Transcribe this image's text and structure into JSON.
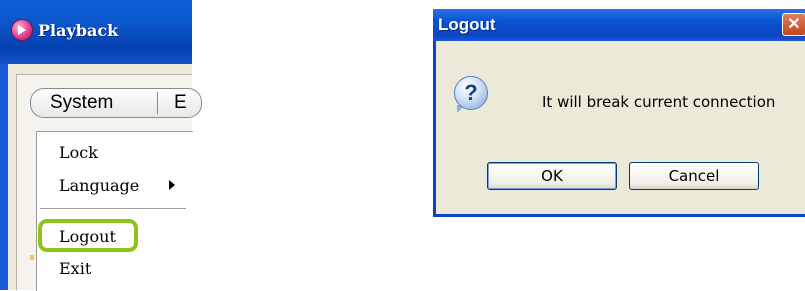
{
  "playback_window": {
    "title": "Playback",
    "menubar": {
      "system_label": "System",
      "next_label_partial": "E"
    },
    "system_menu": {
      "items": [
        {
          "label": "Lock",
          "has_submenu": false
        },
        {
          "label": "Language",
          "has_submenu": true
        },
        {
          "label": "Logout",
          "has_submenu": false,
          "highlighted": true
        },
        {
          "label": "Exit",
          "has_submenu": false
        }
      ]
    },
    "highlight_color": "#8cc41a"
  },
  "logout_dialog": {
    "title": "Logout",
    "icon": "question-icon",
    "message": "It will break current connection",
    "ok_label": "OK",
    "cancel_label": "Cancel"
  },
  "colors": {
    "titlebar_blue": "#0b54c8",
    "window_bg": "#ece9d8",
    "close_button": "#c2451d"
  }
}
